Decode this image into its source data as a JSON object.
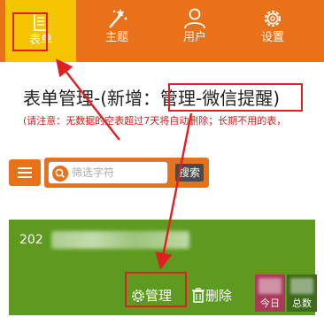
{
  "nav": {
    "items": [
      {
        "label": "表单",
        "icon": "form-icon"
      },
      {
        "label": "主题",
        "icon": "magic-wand-icon"
      },
      {
        "label": "用户",
        "icon": "user-icon"
      },
      {
        "label": "设置",
        "icon": "gear-icon"
      }
    ]
  },
  "page": {
    "title": "表单管理-(新增：管理-微信提醒)",
    "note": "(请注意：无数据的空表超过7天将自动删除；长期不用的表，"
  },
  "toolbar": {
    "menu_icon": "hamburger-icon",
    "search_placeholder": "筛选字符",
    "search_button": "搜索"
  },
  "card": {
    "title_visible_prefix": "202",
    "manage_label": "管理",
    "delete_label": "删除",
    "today_label": "今日",
    "total_label": "总数"
  },
  "colors": {
    "accent": "#e8711a",
    "active_tab": "#f5c400",
    "card_bg": "#5d9a1f",
    "highlight": "#e02020",
    "today_bg": "#a83a5a",
    "total_bg": "#3f6a1c"
  }
}
